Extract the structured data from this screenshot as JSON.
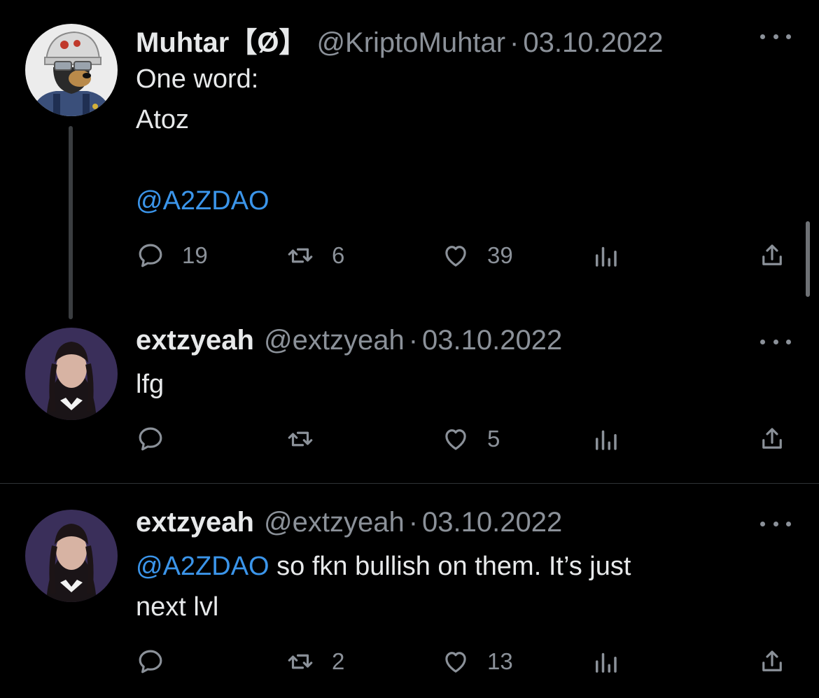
{
  "tweets": [
    {
      "name": "Muhtar【Ø】",
      "handle": "@KriptoMuhtar",
      "separator": "·",
      "date": "03.10.2022",
      "avatar_icon": "cartoon-bear-helmet-avatar",
      "lines": [
        "One word:",
        "Atoz",
        "",
        "@A2ZDAO"
      ],
      "reply_count": "19",
      "retweet_count": "6",
      "like_count": "39"
    },
    {
      "name": "extzyeah",
      "handle": "@extzyeah",
      "separator": "·",
      "date": "03.10.2022",
      "avatar_icon": "girl-braids-portrait-avatar",
      "lines": [
        "lfg"
      ],
      "reply_count": "",
      "retweet_count": "",
      "like_count": "5"
    },
    {
      "name": "extzyeah",
      "handle": "@extzyeah",
      "separator": "·",
      "date": "03.10.2022",
      "avatar_icon": "girl-braids-portrait-avatar",
      "mention": "@A2ZDAO",
      "text_after_mention": " so fkn bullish on them. It’s just",
      "line2": "next lvl",
      "reply_count": "",
      "retweet_count": "2",
      "like_count": "13"
    }
  ],
  "colors": {
    "background": "#000000",
    "text": "#e7e9ea",
    "muted": "#8b9199",
    "link": "#3b95ea"
  }
}
